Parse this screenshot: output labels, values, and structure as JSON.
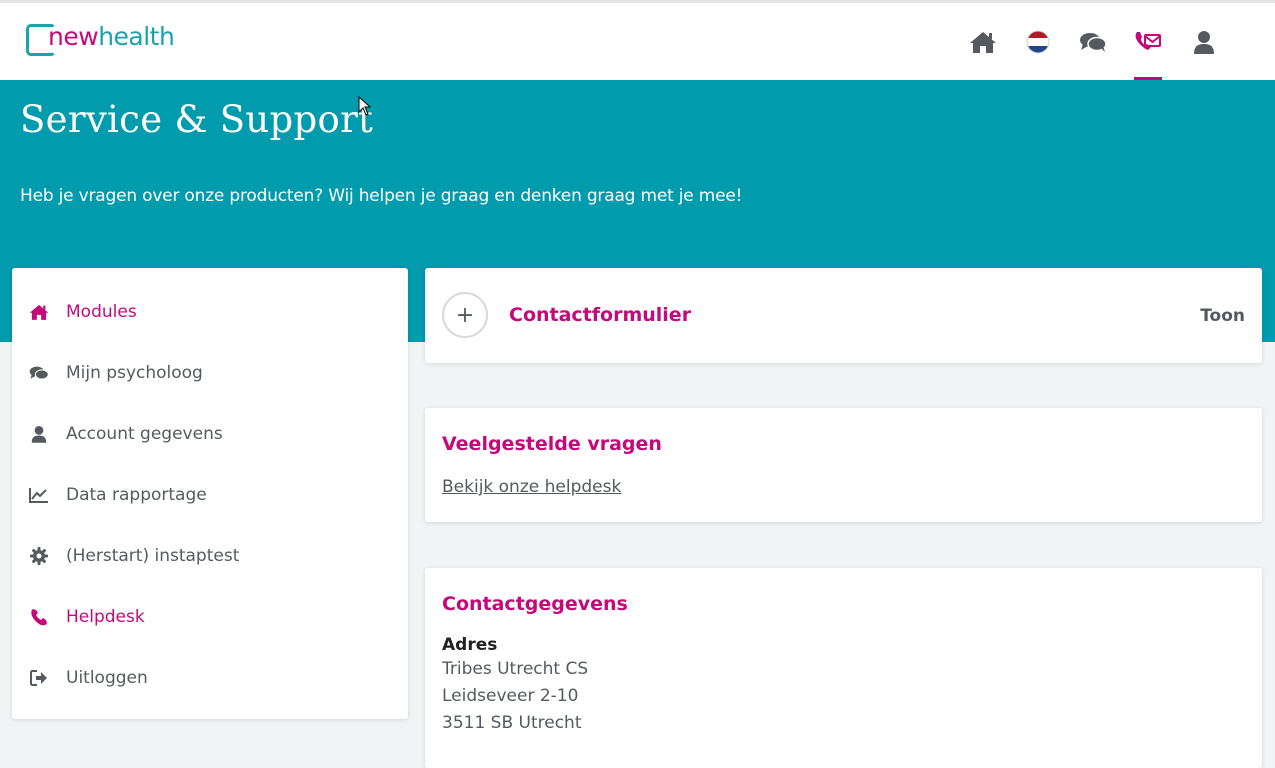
{
  "header": {
    "logo_new": "new",
    "logo_health": "health",
    "icons": [
      "home-icon",
      "flag-nl-icon",
      "chat-icon",
      "support-mail-icon",
      "user-icon"
    ],
    "active_icon": "support-mail-icon"
  },
  "hero": {
    "title": "Service & Support",
    "subtitle": "Heb je vragen over onze producten? Wij helpen je graag en denken graag met je mee!"
  },
  "sidebar": {
    "items": [
      {
        "label": "Modules",
        "icon": "home-icon",
        "active": true
      },
      {
        "label": "Mijn psycholoog",
        "icon": "chat-icon",
        "active": false
      },
      {
        "label": "Account gegevens",
        "icon": "user-icon",
        "active": false
      },
      {
        "label": "Data rapportage",
        "icon": "line-chart-icon",
        "active": false
      },
      {
        "label": "(Herstart) instaptest",
        "icon": "gear-icon",
        "active": false
      },
      {
        "label": "Helpdesk",
        "icon": "phone-icon",
        "active": true
      },
      {
        "label": "Uitloggen",
        "icon": "logout-icon",
        "active": false
      }
    ]
  },
  "contact_form": {
    "expand_symbol": "+",
    "title": "Contactformulier",
    "toggle_label": "Toon"
  },
  "faq": {
    "title": "Veelgestelde vragen",
    "link_label": "Bekijk onze helpdesk"
  },
  "contact_details": {
    "title": "Contactgegevens",
    "address_label": "Adres",
    "address_lines": [
      "Tribes Utrecht CS",
      "Leidseveer 2-10",
      "3511 SB Utrecht"
    ]
  },
  "colors": {
    "brand_magenta": "#c4097a",
    "brand_teal": "#009bad",
    "text_gray": "#555a60",
    "background": "#f2f3f4"
  }
}
